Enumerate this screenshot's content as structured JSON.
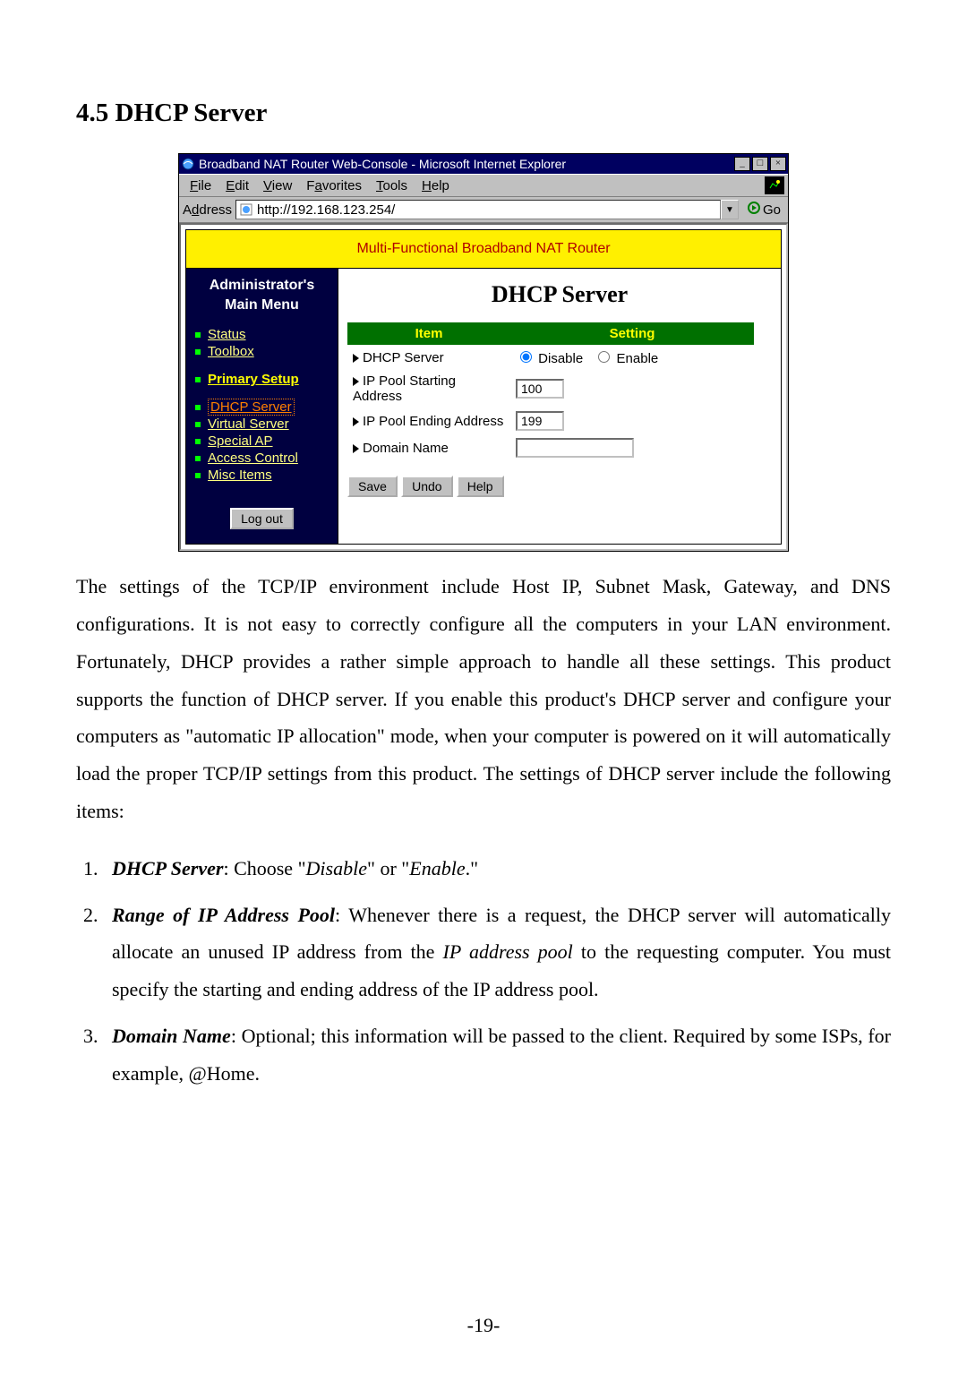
{
  "doc": {
    "heading": "4.5 DHCP Server",
    "paragraph": "The settings of the TCP/IP environment include Host IP, Subnet Mask, Gateway, and DNS configurations. It is not easy to correctly configure all the computers in your LAN environment. Fortunately, DHCP provides a rather simple approach to handle all these settings. This product supports the function of DHCP server. If you enable this product's DHCP server and configure your computers as \"automatic IP allocation\" mode, when your computer is powered on it will automatically load the proper TCP/IP settings from this product. The settings of DHCP server include the following items:",
    "items": {
      "i1": {
        "title": "DHCP Server",
        "rest": ": Choose \"",
        "em1": "Disable",
        "mid": "\" or \"",
        "em2": "Enable",
        "end": ".\""
      },
      "i2": {
        "title": "Range of IP Address Pool",
        "rest": ": Whenever there is a request, the DHCP server will automatically allocate an unused IP address from the ",
        "em1": "IP address pool",
        "end": " to the requesting computer. You must specify the starting and ending address of the IP address pool."
      },
      "i3": {
        "title": "Domain Name",
        "rest": ": Optional; this information will be passed to the client. Required by some ISPs, for example, @Home."
      }
    },
    "page_number": "-19-"
  },
  "ie": {
    "title": "Broadband NAT Router Web-Console - Microsoft Internet Explorer",
    "menus": {
      "file": "File",
      "edit": "Edit",
      "view": "View",
      "favorites": "Favorites",
      "tools": "Tools",
      "help": "Help"
    },
    "address_label": "Address",
    "address_value": "http://192.168.123.254/",
    "go_label": "Go"
  },
  "router": {
    "banner": "Multi-Functional Broadband NAT Router",
    "sidebar_title_l1": "Administrator's",
    "sidebar_title_l2": "Main Menu",
    "menu": {
      "status": "Status",
      "toolbox": "Toolbox",
      "primary_setup": "Primary Setup",
      "dhcp_server": "DHCP Server",
      "virtual_server": "Virtual Server",
      "special_ap": "Special AP",
      "access_control": "Access Control",
      "misc_items": "Misc Items"
    },
    "logout": "Log out",
    "main_title": "DHCP Server",
    "table": {
      "hdr_item": "Item",
      "hdr_setting": "Setting",
      "row_dhcp": "DHCP Server",
      "row_start": "IP Pool Starting Address",
      "row_end": "IP Pool Ending Address",
      "row_domain": "Domain Name",
      "opt_disable": "Disable",
      "opt_enable": "Enable",
      "val_start": "100",
      "val_end": "199",
      "val_domain": ""
    },
    "buttons": {
      "save": "Save",
      "undo": "Undo",
      "help": "Help"
    }
  }
}
